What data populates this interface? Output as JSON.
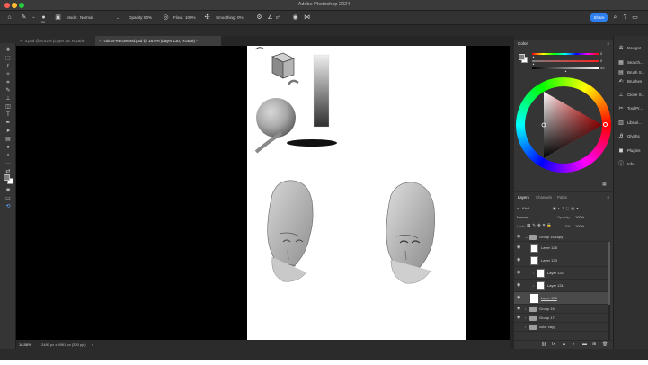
{
  "app": {
    "title": "Adobe Photoshop 2024"
  },
  "options_bar": {
    "mode_label": "Mode:",
    "mode_value": "Normal",
    "opacity_label": "Opacity:",
    "opacity_value": "60%",
    "flow_label": "Flow:",
    "flow_value": "100%",
    "smoothing_label": "Smoothing:",
    "smoothing_value": "0%",
    "angle_value": "0°",
    "brush_size": "50",
    "share_label": "Share"
  },
  "tabs": [
    {
      "label": "4.psd @ 6.42% (Layer 29, RGB/8)",
      "active": false
    },
    {
      "label": "colors-Recovered.psd @ 18.6% (Layer 130, RGB/8) *",
      "active": true
    }
  ],
  "status": {
    "zoom": "18.58%",
    "doc_size": "2480 px x 4961 px (300 ppi)"
  },
  "color_panel": {
    "title": "Color",
    "sliders": [
      {
        "channel": "H",
        "value": "0"
      },
      {
        "channel": "S",
        "value": "0"
      },
      {
        "channel": "B",
        "value": "49"
      }
    ],
    "colors": {
      "hue_marker": "#ff2b2b",
      "foreground": "#7d7d7d",
      "background": "#ffffff"
    }
  },
  "layers_panel": {
    "tabs": [
      "Layers",
      "Channels",
      "Paths"
    ],
    "kind_label": "Kind",
    "blend_mode": "Normal",
    "opacity_label": "Opacity:",
    "opacity_value": "100%",
    "lock_label": "Lock:",
    "fill_label": "Fill:",
    "fill_value": "100%",
    "layers": [
      {
        "name": "Group 16 copy",
        "type": "group",
        "expanded": true,
        "selected": false
      },
      {
        "name": "Layer 128",
        "type": "layer",
        "selected": false
      },
      {
        "name": "Layer 133",
        "type": "layer",
        "selected": false
      },
      {
        "name": "Layer 132",
        "type": "layer",
        "selected": false
      },
      {
        "name": "Layer 131",
        "type": "layer",
        "selected": false
      },
      {
        "name": "Layer 130",
        "type": "layer",
        "selected": true
      },
      {
        "name": "Group 16",
        "type": "group",
        "expanded": false,
        "selected": false
      },
      {
        "name": "Group 17",
        "type": "group",
        "expanded": false,
        "selected": false
      },
      {
        "name": "color vayy",
        "type": "group",
        "expanded": false,
        "selected": false
      }
    ]
  },
  "right_dock": [
    {
      "label": "Navigat...",
      "icon": "navigator-icon"
    },
    {
      "label": "Search...",
      "icon": "search-panel-icon"
    },
    {
      "label": "Brush S...",
      "icon": "brush-settings-icon"
    },
    {
      "label": "Brushes",
      "icon": "brushes-icon"
    },
    {
      "label": "Clone S...",
      "icon": "clone-source-icon"
    },
    {
      "label": "Tool Pr...",
      "icon": "tool-presets-icon"
    },
    {
      "label": "Librari...",
      "icon": "libraries-icon"
    },
    {
      "label": "Glyphs",
      "icon": "glyphs-icon"
    },
    {
      "label": "Plugins",
      "icon": "plugins-icon"
    },
    {
      "label": "Info",
      "icon": "info-icon"
    }
  ]
}
